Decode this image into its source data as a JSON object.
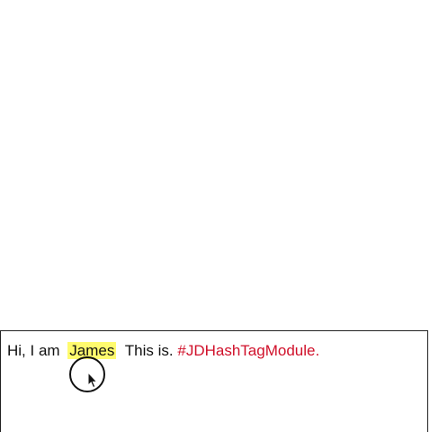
{
  "text_view": {
    "segments": {
      "greeting": "Hi, I am",
      "mention": "James",
      "middle": "This is.",
      "hashtag": "#JDHashTagModule."
    }
  },
  "colors": {
    "mention_highlight": "#fffb6e",
    "hashtag_text": "#d0102a",
    "body_text": "#111111",
    "border": "#222222"
  },
  "icons": {
    "touch_indicator": "touch-circle-icon",
    "pointer": "cursor-arrow-icon"
  }
}
